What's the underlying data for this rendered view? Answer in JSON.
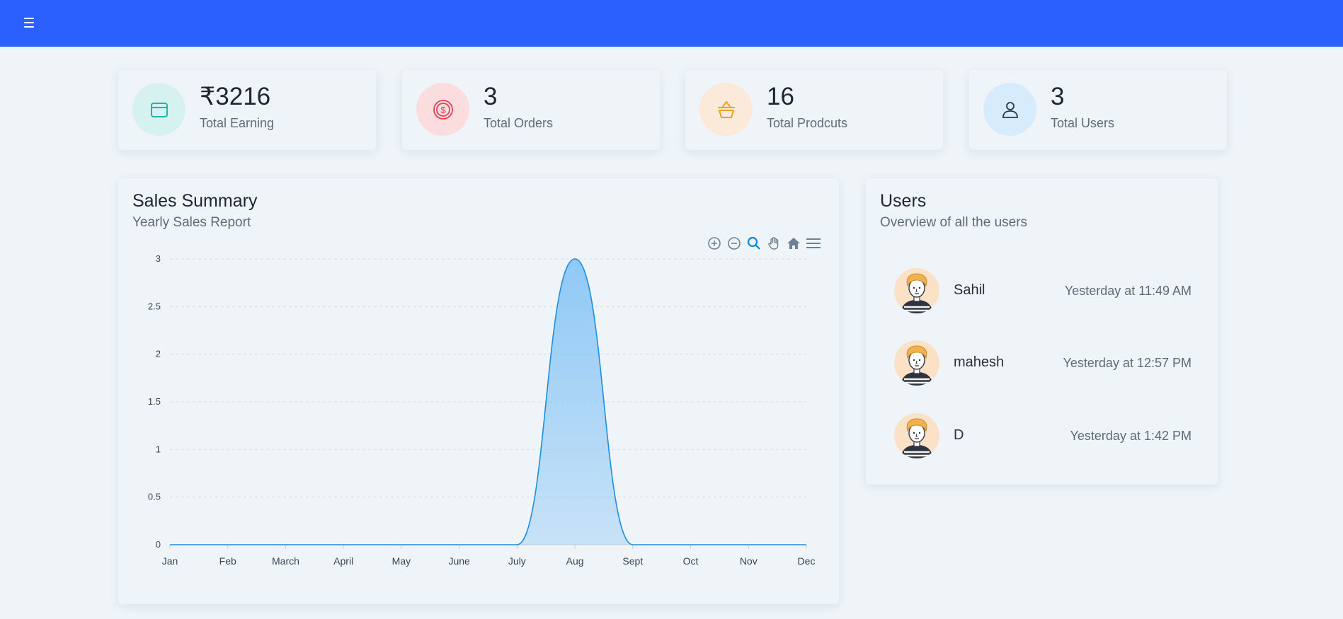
{
  "topbar": {
    "menu_icon": "hamburger-icon",
    "color": "#2b60ff"
  },
  "stats": [
    {
      "value": "₹3216",
      "label": "Total Earning",
      "icon": "wallet-icon",
      "bg": "#d5f1f0",
      "color": "#1fb5a8"
    },
    {
      "value": "3",
      "label": "Total Orders",
      "icon": "dollar-coin-icon",
      "bg": "#fbdde0",
      "color": "#e5414f"
    },
    {
      "value": "16",
      "label": "Total Prodcuts",
      "icon": "basket-icon",
      "bg": "#fbe9d9",
      "color": "#f0a024"
    },
    {
      "value": "3",
      "label": "Total Users",
      "icon": "user-icon",
      "bg": "#d6ebfb",
      "color": "#2b3645"
    }
  ],
  "sales": {
    "title": "Sales Summary",
    "subtitle": "Yearly Sales Report",
    "toolbar": [
      "zoom-in-icon",
      "zoom-out-icon",
      "selection-zoom-icon",
      "pan-icon",
      "reset-home-icon",
      "menu-icon"
    ]
  },
  "chart_data": {
    "type": "area",
    "categories": [
      "Jan",
      "Feb",
      "March",
      "April",
      "May",
      "June",
      "July",
      "Aug",
      "Sept",
      "Oct",
      "Nov",
      "Dec"
    ],
    "series": [
      {
        "values": [
          0,
          0,
          0,
          0,
          0,
          0,
          0,
          3,
          0,
          0,
          0,
          0
        ]
      }
    ],
    "yticks": [
      "0",
      "0.5",
      "1",
      "1.5",
      "2",
      "2.5",
      "3"
    ],
    "ylim": [
      0,
      3
    ],
    "grid": true,
    "smooth": true,
    "line_color": "#1e8fe0",
    "fill_color": "#7fc1f5"
  },
  "users": {
    "title": "Users",
    "subtitle": "Overview of all the users",
    "list": [
      {
        "name": "Sahil",
        "time": "Yesterday at 11:49 AM"
      },
      {
        "name": "mahesh",
        "time": "Yesterday at 12:57 PM"
      },
      {
        "name": "D",
        "time": "Yesterday at 1:42 PM"
      }
    ]
  }
}
